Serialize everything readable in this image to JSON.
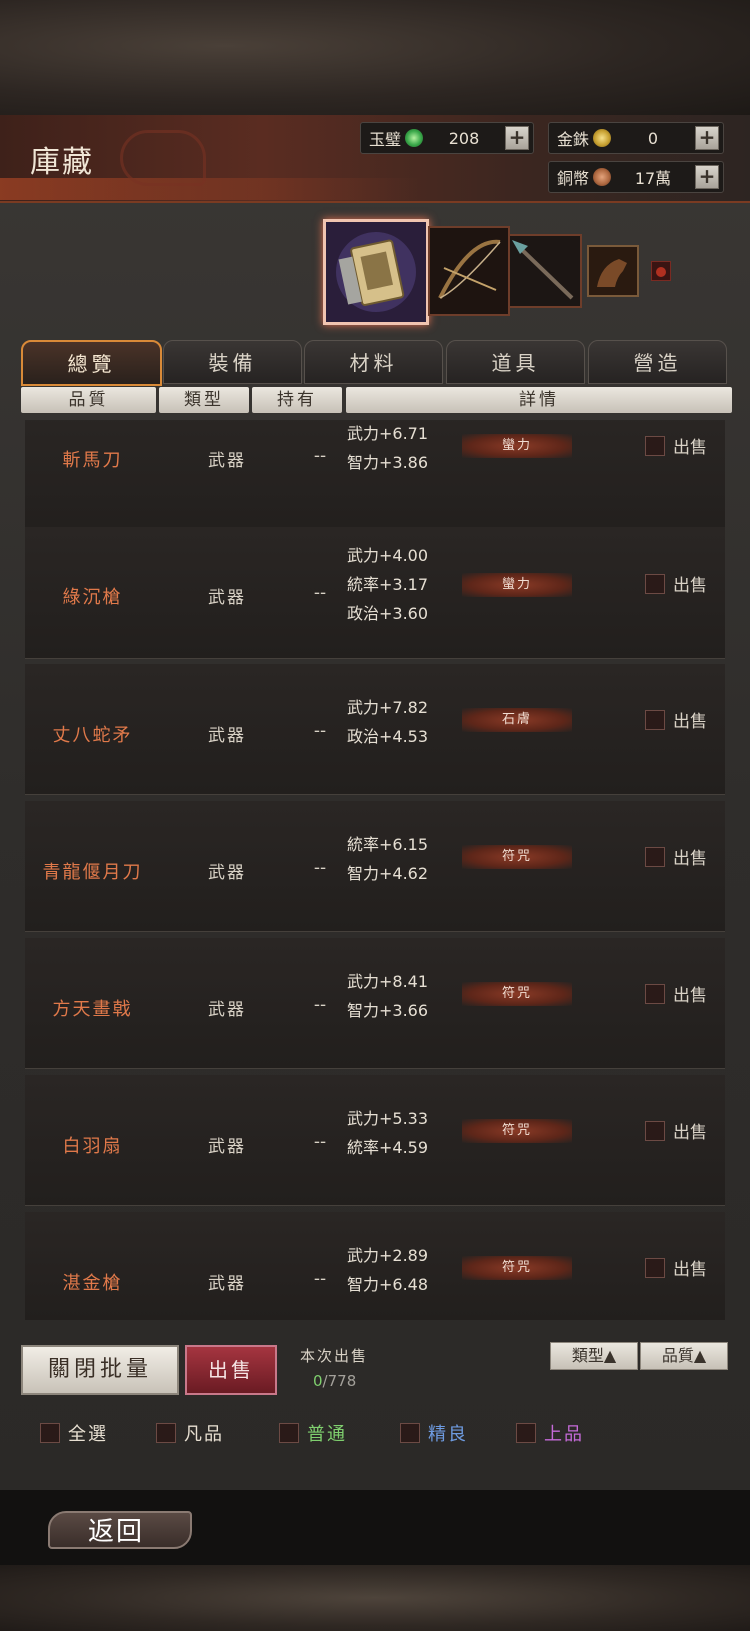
{
  "header": {
    "title": "庫藏",
    "currencies": [
      {
        "label": "玉璧",
        "value": "208",
        "coin_color": "#3aa84a"
      },
      {
        "label": "金銖",
        "value": "0",
        "coin_color": "#c8a132"
      },
      {
        "label": "銅幣",
        "value": "17萬",
        "coin_color": "#b06a42"
      }
    ],
    "plus_symbol": "+"
  },
  "tabs": [
    "總覽",
    "裝備",
    "材料",
    "道具",
    "營造"
  ],
  "columns": [
    "品質",
    "類型",
    "持有",
    "詳情"
  ],
  "items": [
    {
      "name": "斬馬刀",
      "type": "武器",
      "hold": "--",
      "stats": [
        "武力+6.71",
        "智力+3.86"
      ],
      "tag": "蠻力",
      "sell": "出售"
    },
    {
      "name": "綠沉槍",
      "type": "武器",
      "hold": "--",
      "stats": [
        "武力+4.00",
        "統率+3.17",
        "政治+3.60"
      ],
      "tag": "蠻力",
      "sell": "出售"
    },
    {
      "name": "丈八蛇矛",
      "type": "武器",
      "hold": "--",
      "stats": [
        "武力+7.82",
        "政治+4.53"
      ],
      "tag": "石膚",
      "sell": "出售"
    },
    {
      "name": "青龍偃月刀",
      "type": "武器",
      "hold": "--",
      "stats": [
        "統率+6.15",
        "智力+4.62"
      ],
      "tag": "符咒",
      "sell": "出售"
    },
    {
      "name": "方天畫戟",
      "type": "武器",
      "hold": "--",
      "stats": [
        "武力+8.41",
        "智力+3.66"
      ],
      "tag": "符咒",
      "sell": "出售"
    },
    {
      "name": "白羽扇",
      "type": "武器",
      "hold": "--",
      "stats": [
        "武力+5.33",
        "統率+4.59"
      ],
      "tag": "符咒",
      "sell": "出售"
    },
    {
      "name": "湛金槍",
      "type": "武器",
      "hold": "--",
      "stats": [
        "武力+2.89",
        "智力+6.48"
      ],
      "tag": "符咒",
      "sell": "出售"
    }
  ],
  "bottom": {
    "batch_close": "關閉批量",
    "sell": "出售",
    "sale_label": "本次出售",
    "sale_selected": "0",
    "sale_total": "/778",
    "sort_type": "類型▲",
    "sort_quality": "品質▲"
  },
  "filters": [
    {
      "label": "全選",
      "color": "#e8e0d2"
    },
    {
      "label": "凡品",
      "color": "#e8e0d2"
    },
    {
      "label": "普通",
      "color": "#7fcf6e"
    },
    {
      "label": "精良",
      "color": "#6e9be0"
    },
    {
      "label": "上品",
      "color": "#c56ad8"
    }
  ],
  "footer": {
    "back": "返回"
  }
}
